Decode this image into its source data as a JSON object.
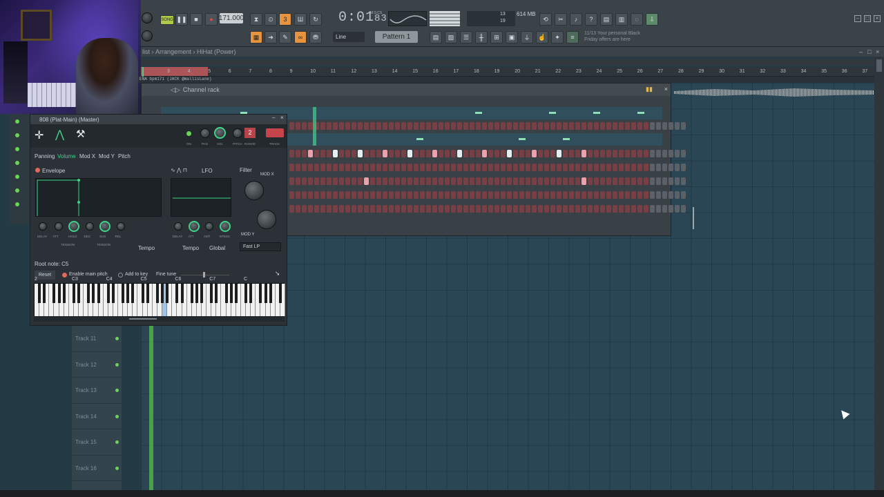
{
  "toolbar": {
    "mode_label": "SONG",
    "tempo": "171.000",
    "time": "0:01",
    "time_frac": "83",
    "time_unit": "M:S:CS",
    "memory": "614 MB",
    "cpu_a": "13",
    "cpu_b": "19",
    "snap": "Line",
    "pattern": "Pattern 1",
    "hint_count": "11/13",
    "hint": "Your personal Black Friday offers are here"
  },
  "playlist": {
    "breadcrumb": [
      "list",
      "Arrangement",
      "HiHat (Power)"
    ],
    "ruler": [
      "3",
      "4",
      "5",
      "6",
      "7",
      "8",
      "9",
      "10",
      "11",
      "12",
      "13",
      "14",
      "15",
      "16",
      "17",
      "18",
      "19",
      "20",
      "21",
      "22",
      "23",
      "24",
      "25",
      "26",
      "27",
      "28",
      "29",
      "30",
      "31",
      "32",
      "33",
      "34",
      "35",
      "36",
      "37"
    ],
    "clip_label": "ENA bpm171 (JACK @WallisLane)",
    "tracks": [
      "Track 11",
      "Track 12",
      "Track 13",
      "Track 14",
      "Track 15",
      "Track 16"
    ]
  },
  "channel_rack": {
    "title": "Channel rack"
  },
  "plugin": {
    "title": "808 (Plat-Main) (Master)",
    "header_labels": [
      "ON",
      "PAN",
      "VOL",
      "PITCH",
      "RANGE",
      "TRACK"
    ],
    "range_value": "2",
    "tabs": [
      "Panning",
      "Volume",
      "Mod X",
      "Mod Y",
      "Pitch"
    ],
    "envelope": "Envelope",
    "lfo": "LFO",
    "filter": "Filter",
    "mod_x": "MOD X",
    "mod_y": "MOD Y",
    "env_knobs": [
      "DELAY",
      "ATT",
      "HOLD",
      "DEC",
      "SUS",
      "REL"
    ],
    "lfo_knobs": [
      "DELAY",
      "ATT",
      "AMT",
      "SPEED"
    ],
    "tension": "TENSION",
    "tempo": "Tempo",
    "global": "Global",
    "filter_type": "Fast LP",
    "root_note": "Root note: C5",
    "reset": "Reset",
    "enable_pitch": "Enable main pitch",
    "add_to_key": "Add to key",
    "fine_tune": "Fine tune",
    "octaves": [
      "2",
      "C3",
      "C4",
      "C5",
      "C6",
      "C7",
      "C"
    ]
  },
  "colors": {
    "accent": "#3fd48a",
    "step_red": "#7a3f45",
    "bg": "#243a45"
  }
}
